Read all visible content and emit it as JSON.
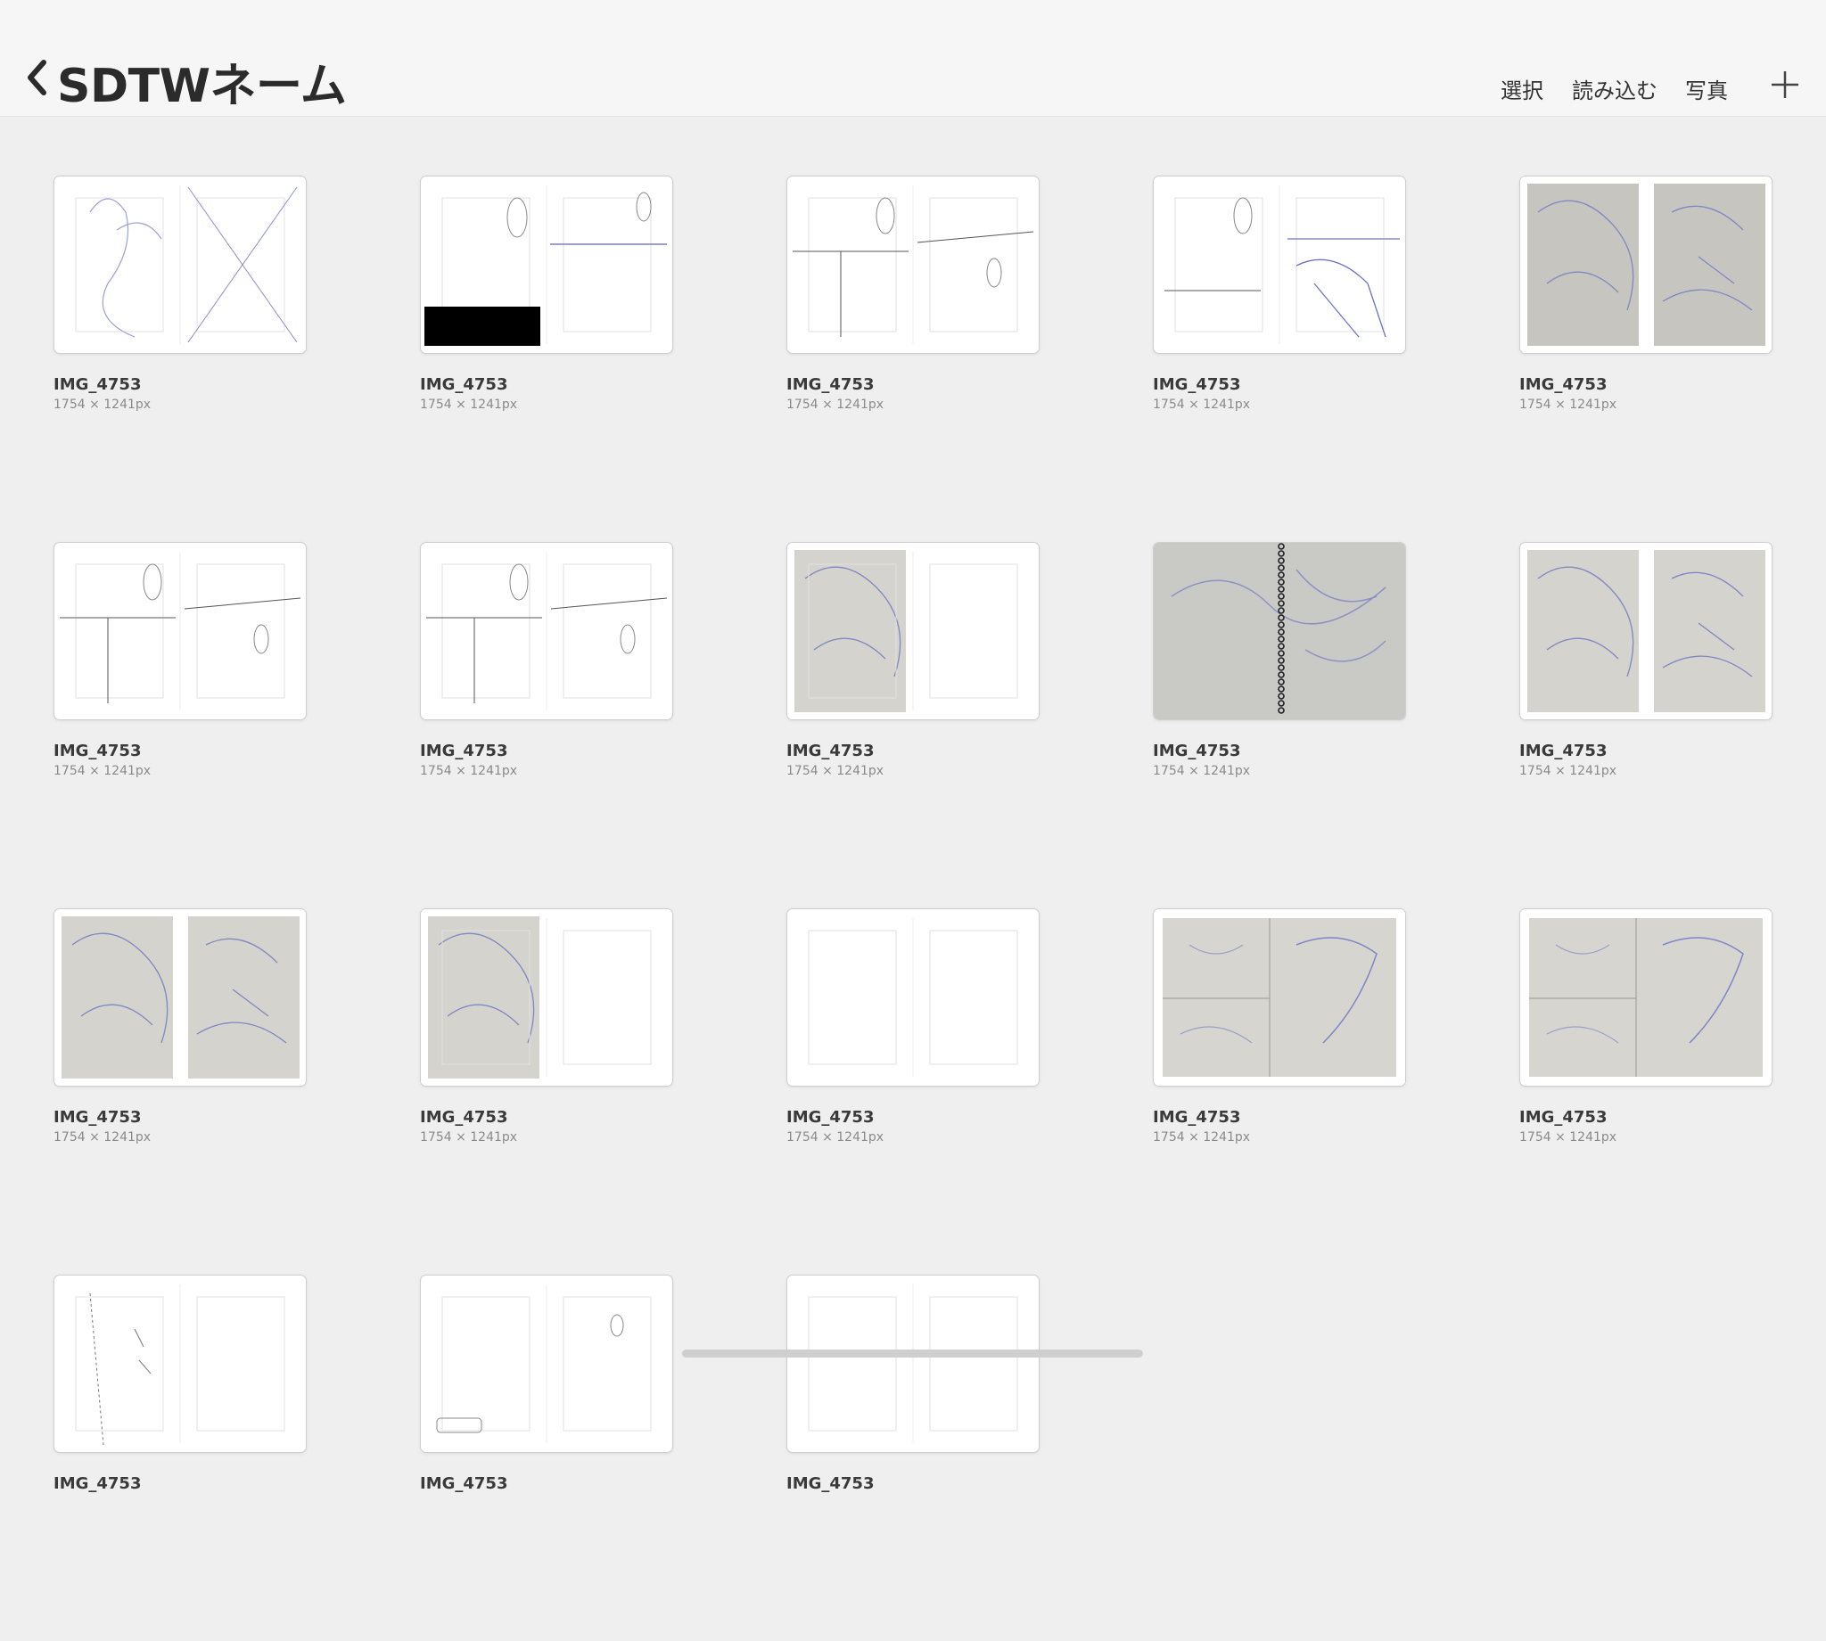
{
  "header": {
    "back_icon": "chevron-left-icon",
    "title": "SDTWネーム",
    "select_label": "選択",
    "import_label": "読み込む",
    "photos_label": "写真",
    "add_icon": "plus-icon"
  },
  "items": [
    {
      "name": "IMG_4753",
      "dims": "1754 × 1241px",
      "style": "sketch-x"
    },
    {
      "name": "IMG_4753",
      "dims": "1754 × 1241px",
      "style": "balloons-black"
    },
    {
      "name": "IMG_4753",
      "dims": "1754 × 1241px",
      "style": "panels"
    },
    {
      "name": "IMG_4753",
      "dims": "1754 × 1241px",
      "style": "balloons-city"
    },
    {
      "name": "IMG_4753",
      "dims": "1754 × 1241px",
      "style": "photo-dark"
    },
    {
      "name": "IMG_4753",
      "dims": "1754 × 1241px",
      "style": "panels"
    },
    {
      "name": "IMG_4753",
      "dims": "1754 × 1241px",
      "style": "panels"
    },
    {
      "name": "IMG_4753",
      "dims": "1754 × 1241px",
      "style": "photo-left"
    },
    {
      "name": "IMG_4753",
      "dims": "1754 × 1241px",
      "style": "notebook"
    },
    {
      "name": "IMG_4753",
      "dims": "1754 × 1241px",
      "style": "photo-both"
    },
    {
      "name": "IMG_4753",
      "dims": "1754 × 1241px",
      "style": "photo-both"
    },
    {
      "name": "IMG_4753",
      "dims": "1754 × 1241px",
      "style": "photo-left"
    },
    {
      "name": "IMG_4753",
      "dims": "1754 × 1241px",
      "style": "blank"
    },
    {
      "name": "IMG_4753",
      "dims": "1754 × 1241px",
      "style": "photo-wide"
    },
    {
      "name": "IMG_4753",
      "dims": "1754 × 1241px",
      "style": "photo-wide"
    },
    {
      "name": "IMG_4753",
      "dims": "",
      "style": "sketch-lines"
    },
    {
      "name": "IMG_4753",
      "dims": "",
      "style": "balloons"
    },
    {
      "name": "IMG_4753",
      "dims": "",
      "style": "blank"
    }
  ]
}
